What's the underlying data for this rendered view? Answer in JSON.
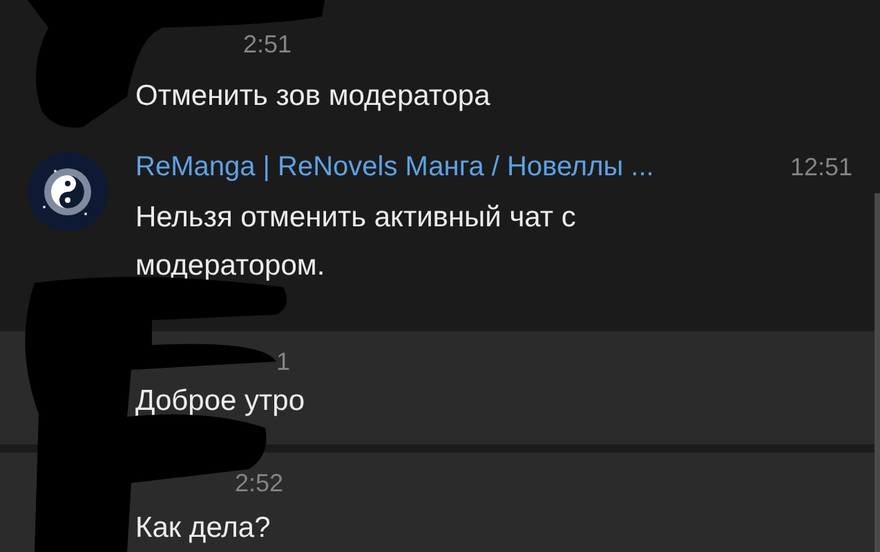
{
  "messages": [
    {
      "kind": "plain",
      "time": "2:51",
      "text": "Отменить зов модератора",
      "selected": false
    },
    {
      "kind": "full",
      "sender": "ReManga | ReNovels Манга / Новеллы ...",
      "time": "12:51",
      "text": "Нельзя отменить активный чат с модератором.",
      "selected": false
    },
    {
      "kind": "plain",
      "time": "1",
      "text": "Доброе утро",
      "selected": true
    },
    {
      "kind": "plain",
      "time": "2:52",
      "text": "Как дела?",
      "selected": true
    }
  ]
}
